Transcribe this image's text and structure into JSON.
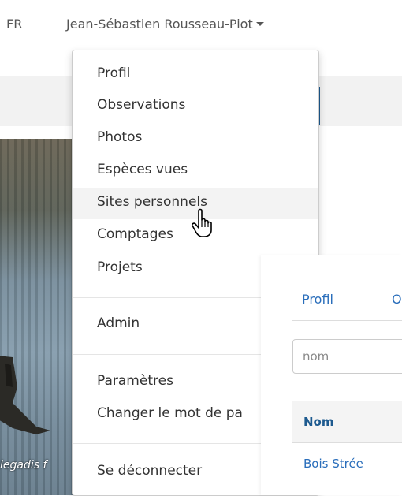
{
  "topbar": {
    "lang": "FR",
    "user_name": "Jean-Sébastien Rousseau-Piot"
  },
  "photo": {
    "caption": "legadis f"
  },
  "menu": {
    "items": [
      {
        "label": "Profil"
      },
      {
        "label": "Observations"
      },
      {
        "label": "Photos"
      },
      {
        "label": "Espèces vues"
      },
      {
        "label": "Sites personnels",
        "hover": true
      },
      {
        "label": "Comptages"
      },
      {
        "label": "Projets"
      },
      {
        "label": "Admin"
      },
      {
        "label": "Paramètres"
      },
      {
        "label": "Changer le mot de pa"
      },
      {
        "label": "Se déconnecter"
      }
    ]
  },
  "panel": {
    "tabs": [
      "Profil",
      "O"
    ],
    "search_placeholder": "nom",
    "table": {
      "header": "Nom",
      "rows": [
        "Bois Strée"
      ]
    }
  },
  "colors": {
    "link": "#2a6ebb",
    "header_text": "#1d5a8f",
    "accent": "#1d5a8f"
  }
}
